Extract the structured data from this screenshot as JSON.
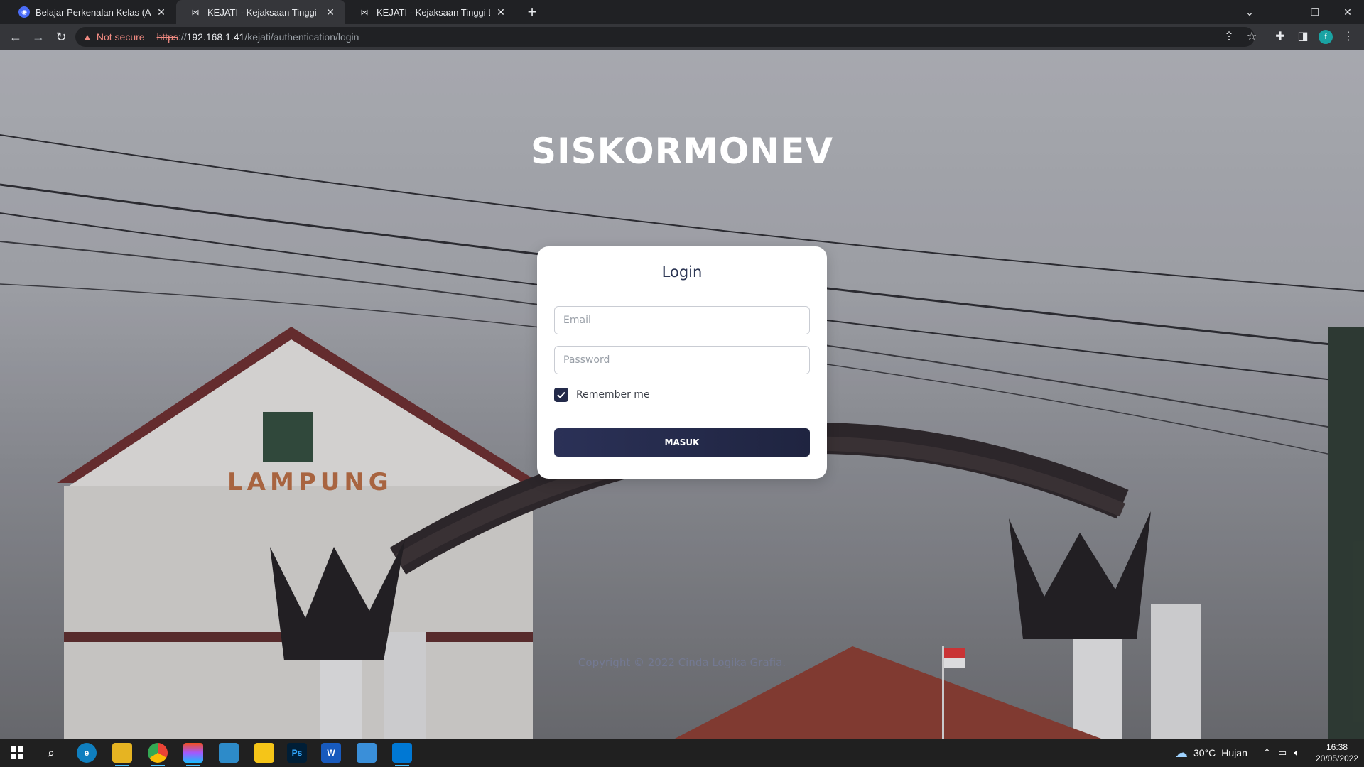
{
  "browser": {
    "tabs": [
      {
        "title": "Belajar Perkenalan Kelas (Adobe",
        "icon": "adobe-icon",
        "active": false
      },
      {
        "title": "KEJATI - Kejaksaan Tinggi Lampu",
        "icon": "kejati-icon",
        "active": true
      },
      {
        "title": "KEJATI - Kejaksaan Tinggi Lampu",
        "icon": "kejati-icon",
        "active": false
      }
    ],
    "security_label": "Not secure",
    "url_scheme": "https",
    "url_sep": "://",
    "url_host": "192.168.1.41",
    "url_path": "/kejati/authentication/login",
    "profile_initial": "f"
  },
  "page": {
    "app_title": "SISKORMONEV",
    "login": {
      "title": "Login",
      "email_placeholder": "Email",
      "password_placeholder": "Password",
      "remember_label": "Remember me",
      "remember_checked": true,
      "submit_label": "MASUK"
    },
    "copyright": "Copyright © 2022 Cinda Logika Grafia."
  },
  "taskbar": {
    "apps": [
      "windows-start-icon",
      "search-icon",
      "edge-icon",
      "file-explorer-icon",
      "chrome-icon",
      "figma-icon",
      "app-icon",
      "sticky-notes-icon",
      "photoshop-icon",
      "word-icon",
      "photos-icon",
      "vscode-icon"
    ],
    "photoshop_label": "Ps",
    "word_label": "W",
    "weather_temp": "30°C",
    "weather_text": "Hujan",
    "time": "16:38",
    "date": "20/05/2022"
  },
  "colors": {
    "primary_button": "#232a4a",
    "card_title": "#2c3654",
    "chrome_bg": "#202124",
    "toolbar_bg": "#35363a"
  }
}
